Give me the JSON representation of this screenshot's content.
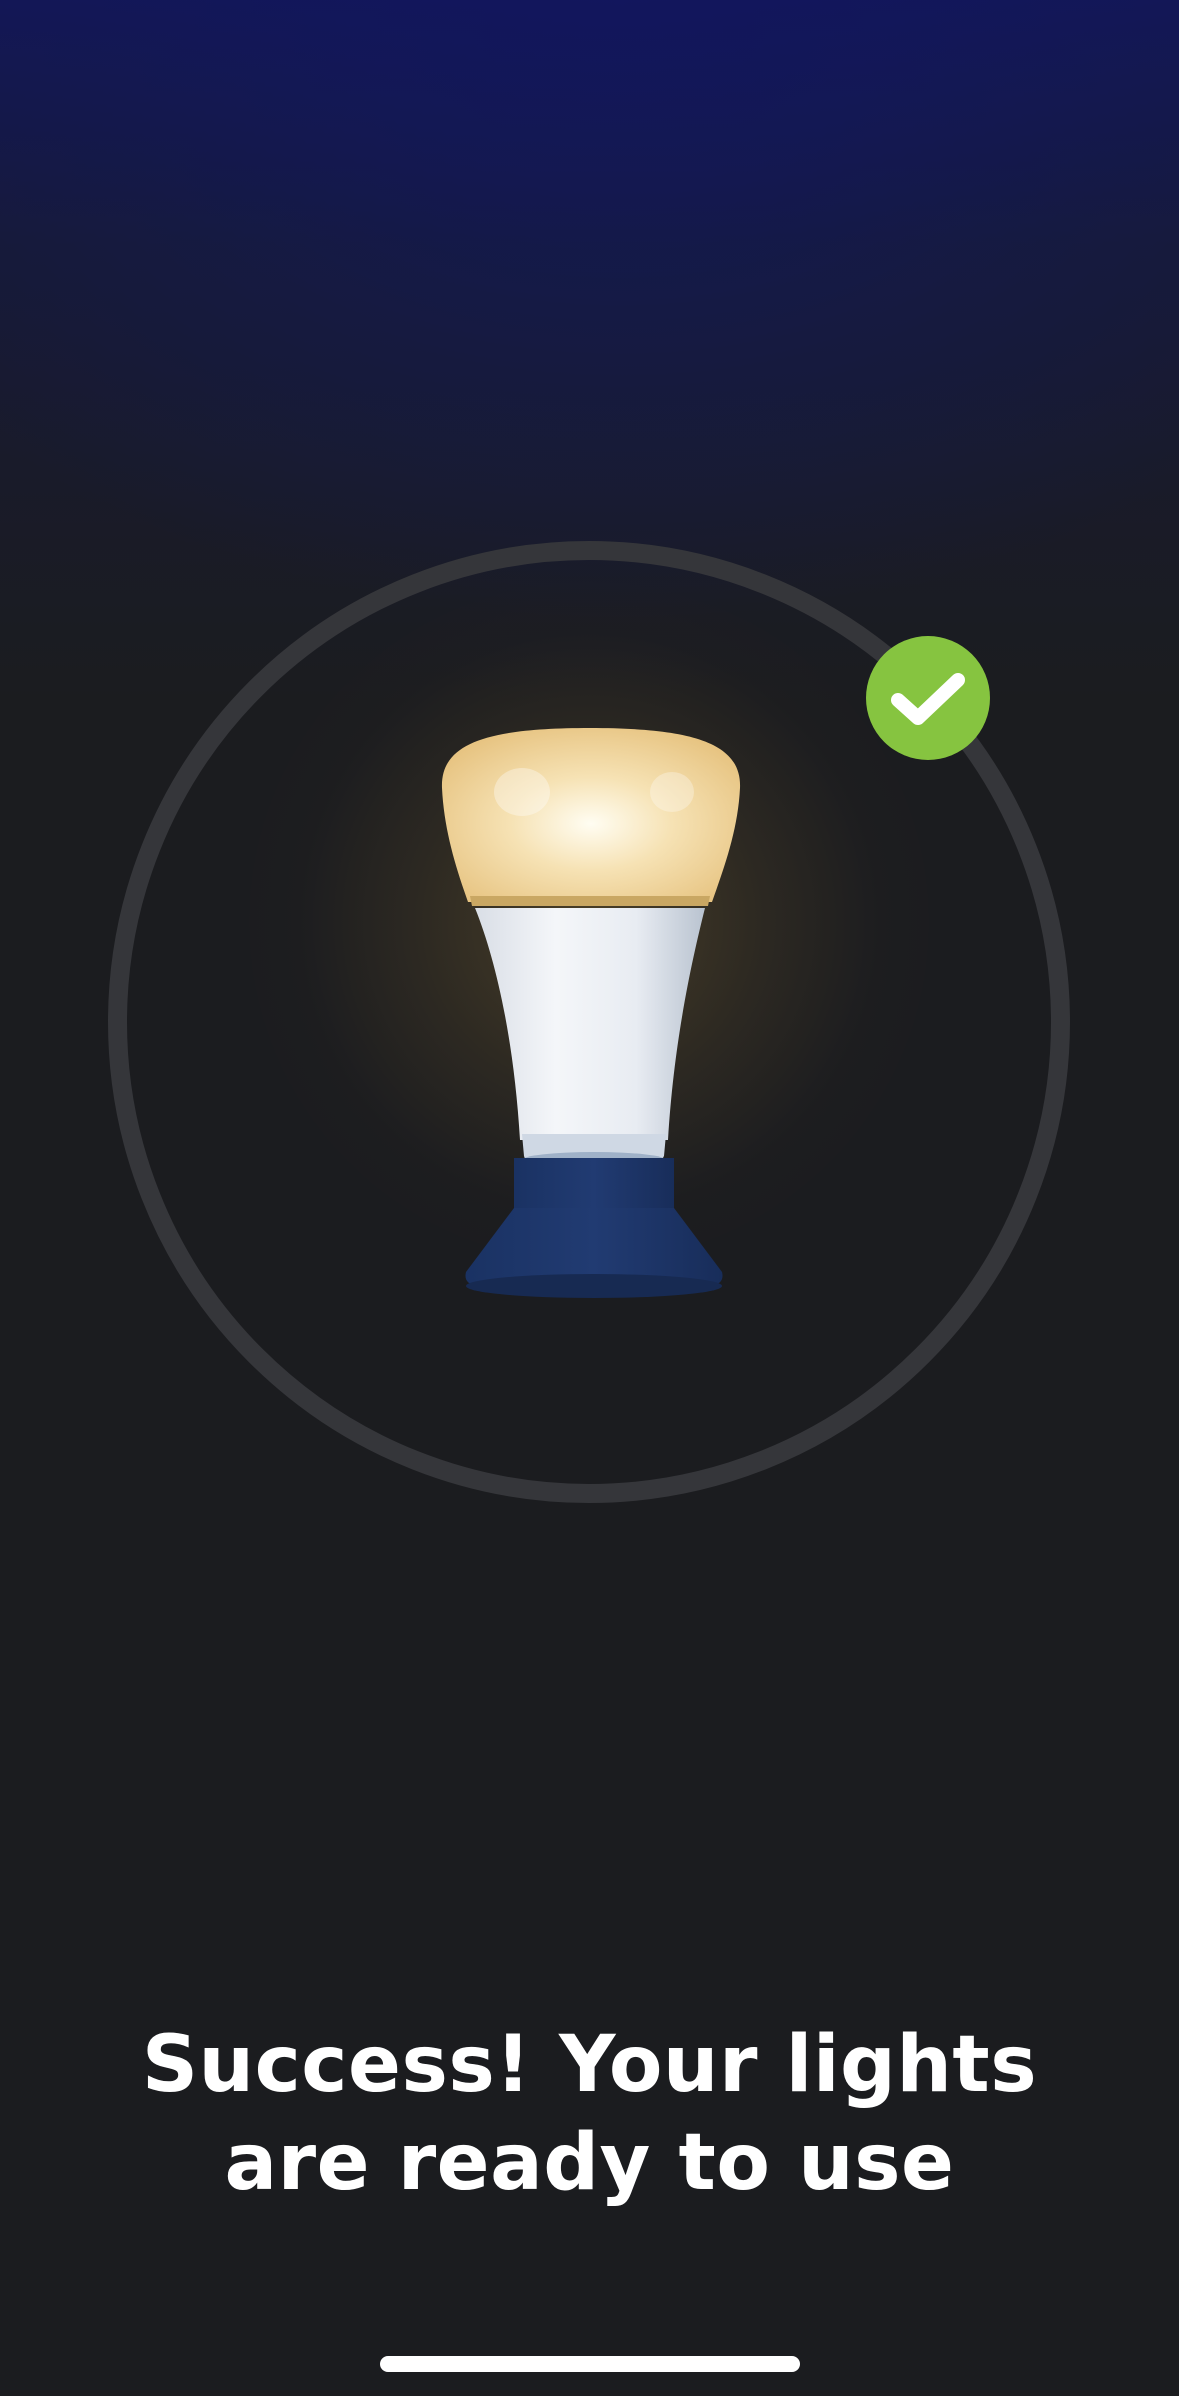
{
  "screen": {
    "illustration": {
      "subject": "light-bulb",
      "status_icon": "check-icon",
      "status_color": "#86c440",
      "ring_color": "#35363a"
    },
    "message": {
      "title": "Success! Your lights are ready to use"
    },
    "colors": {
      "background": "#1b1c1f",
      "top_gradient": "#121762",
      "text": "#ffffff"
    }
  }
}
